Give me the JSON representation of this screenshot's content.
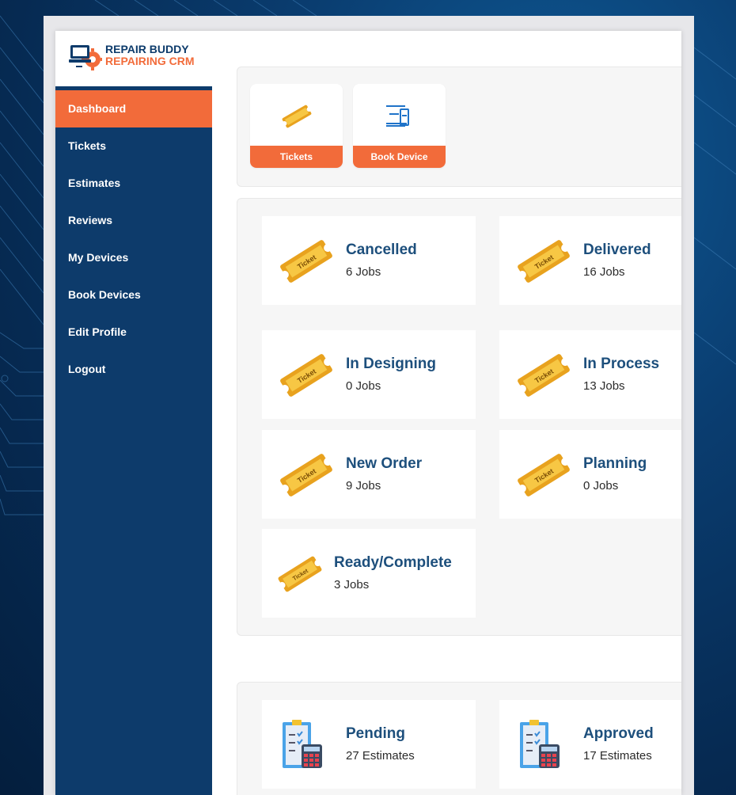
{
  "brand": {
    "line1": "REPAIR BUDDY",
    "line2": "REPAIRING CRM",
    "accent_color": "#f26b3a",
    "navy_color": "#0d3b6b",
    "icon": "laptop-gear-logo"
  },
  "sidebar": {
    "items": [
      {
        "label": "Dashboard",
        "active": true
      },
      {
        "label": "Tickets"
      },
      {
        "label": "Estimates"
      },
      {
        "label": "Reviews"
      },
      {
        "label": "My Devices"
      },
      {
        "label": "Book Devices"
      },
      {
        "label": "Edit Profile"
      },
      {
        "label": "Logout"
      }
    ]
  },
  "quick_actions": [
    {
      "label": "Tickets",
      "icon": "ticket-icon"
    },
    {
      "label": "Book Device",
      "icon": "devices-icon"
    }
  ],
  "ticket_stats": [
    {
      "title": "Cancelled",
      "count": "6 Jobs",
      "icon": "ticket-icon"
    },
    {
      "title": "Delivered",
      "count": "16 Jobs",
      "icon": "ticket-icon"
    },
    {
      "title": "In Designing",
      "count": "0 Jobs",
      "icon": "ticket-icon"
    },
    {
      "title": "In Process",
      "count": "13 Jobs",
      "icon": "ticket-icon"
    },
    {
      "title": "New Order",
      "count": "9 Jobs",
      "icon": "ticket-icon"
    },
    {
      "title": "Planning",
      "count": "0 Jobs",
      "icon": "ticket-icon"
    },
    {
      "title": "Ready/Complete",
      "count": "3 Jobs",
      "icon": "ticket-icon"
    }
  ],
  "estimate_stats": [
    {
      "title": "Pending",
      "count": "27 Estimates",
      "icon": "estimate-calculator-icon"
    },
    {
      "title": "Approved",
      "count": "17 Estimates",
      "icon": "estimate-calculator-icon"
    }
  ],
  "ticket_icon_text": "Ticket"
}
